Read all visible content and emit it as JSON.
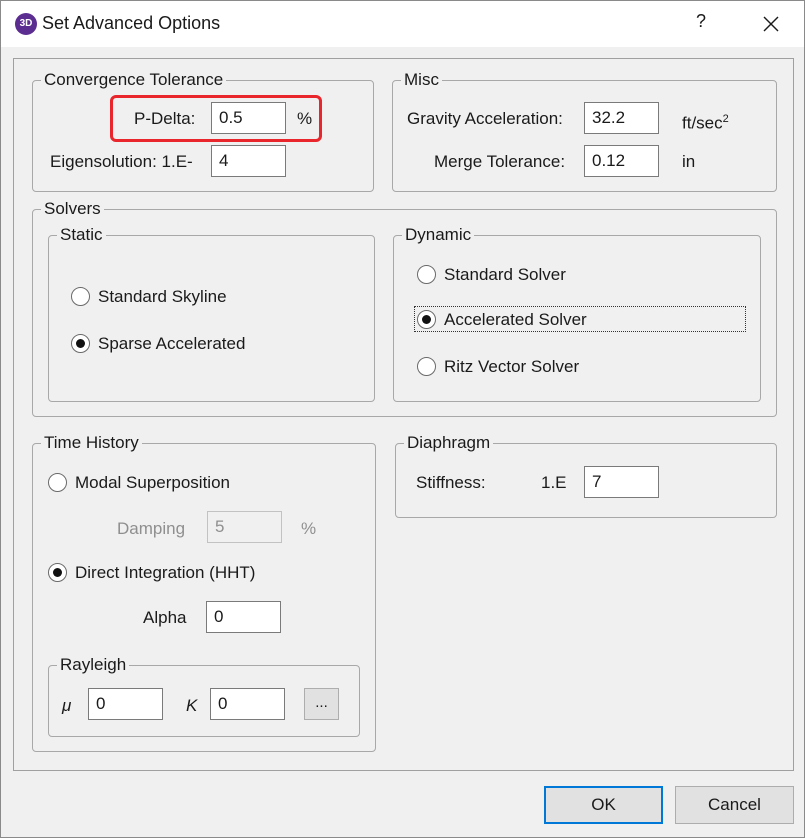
{
  "window": {
    "title": "Set Advanced Options",
    "help": "?"
  },
  "convergence": {
    "legend": "Convergence Tolerance",
    "pdelta_label": "P-Delta:",
    "pdelta_value": "0.5",
    "pdelta_unit": "%",
    "eigen_label": "Eigensolution: 1.E-",
    "eigen_value": "4"
  },
  "misc": {
    "legend": "Misc",
    "gravity_label": "Gravity Acceleration:",
    "gravity_value": "32.2",
    "gravity_unit": "ft/sec",
    "gravity_unit_sup": "2",
    "merge_label": "Merge Tolerance:",
    "merge_value": "0.12",
    "merge_unit": "in"
  },
  "solvers": {
    "legend": "Solvers",
    "static": {
      "legend": "Static",
      "options": [
        "Standard Skyline",
        "Sparse Accelerated"
      ],
      "selected": "Sparse Accelerated"
    },
    "dynamic": {
      "legend": "Dynamic",
      "options": [
        "Standard Solver",
        "Accelerated Solver",
        "Ritz Vector Solver"
      ],
      "selected": "Accelerated Solver"
    }
  },
  "time_history": {
    "legend": "Time History",
    "modal_label": "Modal Superposition",
    "damping_label": "Damping",
    "damping_value": "5",
    "damping_unit": "%",
    "direct_label": "Direct Integration (HHT)",
    "selected": "Direct Integration (HHT)",
    "alpha_label": "Alpha",
    "alpha_value": "0",
    "rayleigh": {
      "legend": "Rayleigh",
      "mu_label": "μ",
      "mu_value": "0",
      "k_label": "K",
      "k_value": "0",
      "more_label": "..."
    }
  },
  "diaphragm": {
    "legend": "Diaphragm",
    "stiffness_label": "Stiffness:",
    "prefix": "1.E",
    "value": "7"
  },
  "buttons": {
    "ok": "OK",
    "cancel": "Cancel"
  },
  "colors": {
    "highlight": "#e8262b",
    "focus": "#0078d7",
    "app_icon": "#5b2d91"
  },
  "icons": {
    "app": "3D",
    "close": "close-icon"
  }
}
